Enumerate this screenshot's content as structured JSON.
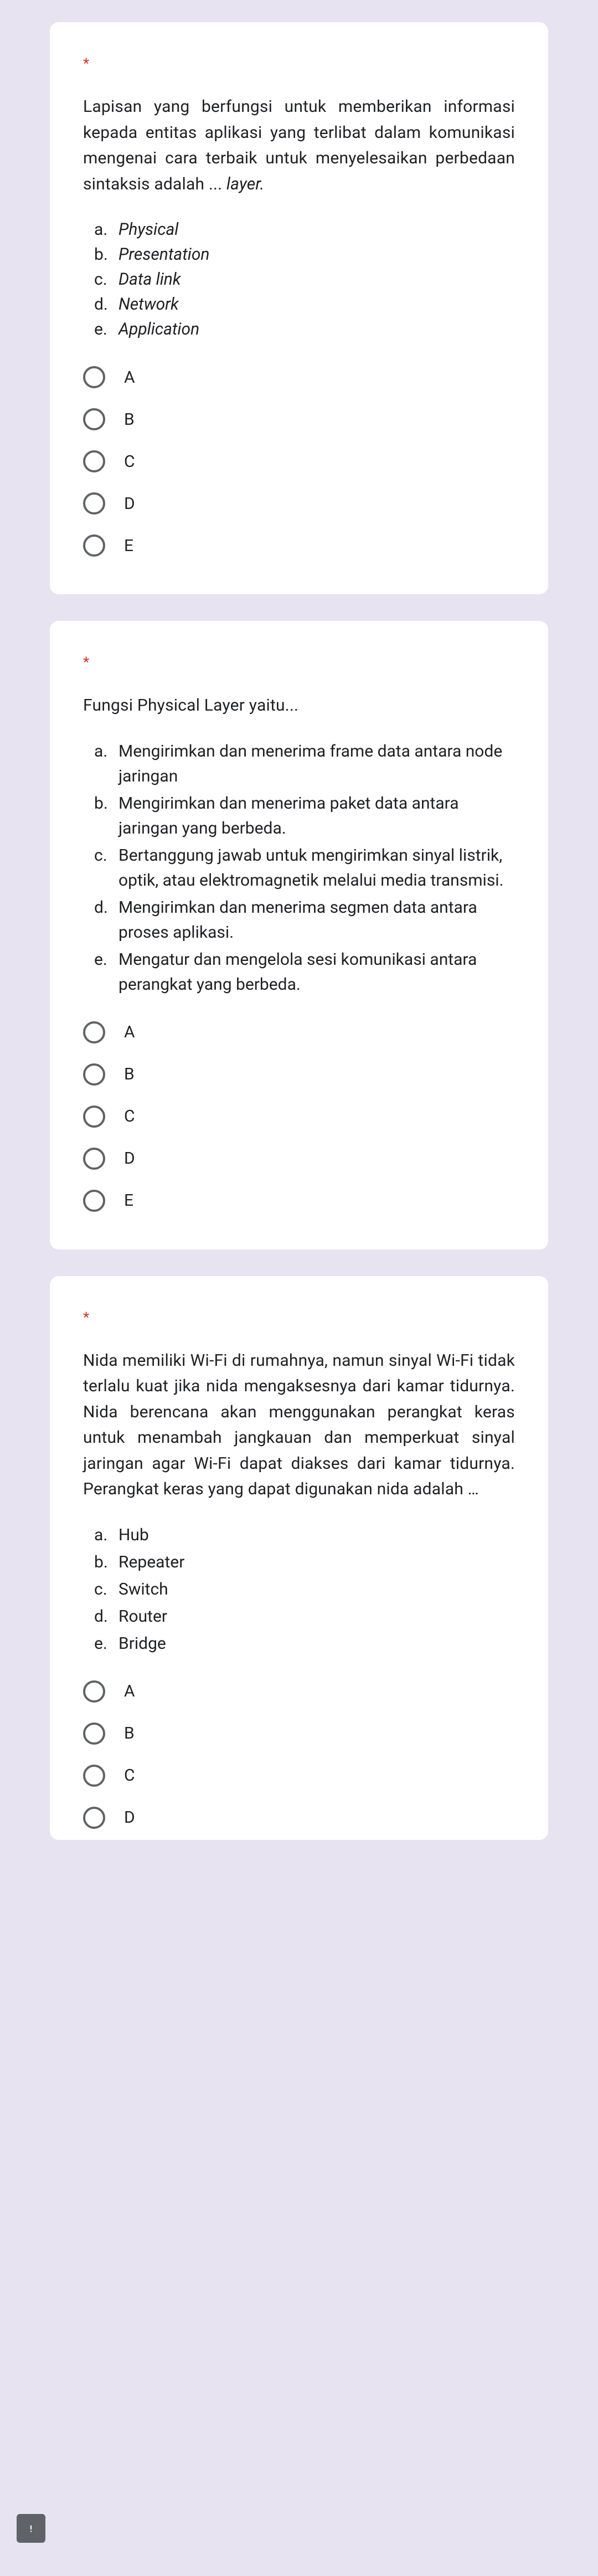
{
  "required_marker": "*",
  "choices": [
    "A",
    "B",
    "C",
    "D",
    "E"
  ],
  "questions": [
    {
      "id": "q1",
      "text_parts": [
        "Lapisan yang berfungsi untuk memberikan informasi kepada entitas aplikasi yang terlibat dalam komunikasi mengenai cara terbaik untuk menyelesaikan perbedaan sintaksis adalah ... ",
        "layer."
      ],
      "justify": true,
      "options_italic": true,
      "options": [
        {
          "letter": "a.",
          "text": "Physical"
        },
        {
          "letter": "b.",
          "text": "Presentation"
        },
        {
          "letter": "c.",
          "text": "Data link"
        },
        {
          "letter": "d.",
          "text": "Network"
        },
        {
          "letter": "e.",
          "text": "Application"
        }
      ]
    },
    {
      "id": "q2",
      "text_parts": [
        "Fungsi Physical Layer yaitu..."
      ],
      "justify": false,
      "options_italic": false,
      "options": [
        {
          "letter": "a.",
          "text": "Mengirimkan dan menerima frame data antara node jaringan"
        },
        {
          "letter": "b.",
          "text": "Mengirimkan dan menerima paket data antara jaringan yang berbeda."
        },
        {
          "letter": "c.",
          "text": "Bertanggung jawab untuk mengirimkan sinyal listrik, optik, atau elektromagnetik melalui media transmisi."
        },
        {
          "letter": "d.",
          "text": "Mengirimkan dan menerima segmen data antara proses aplikasi."
        },
        {
          "letter": "e.",
          "text": "Mengatur dan mengelola sesi komunikasi antara perangkat yang berbeda."
        }
      ]
    },
    {
      "id": "q3",
      "text_parts": [
        "Nida memiliki Wi-Fi di rumahnya, namun sinyal Wi-Fi tidak terlalu kuat jika nida mengaksesnya dari kamar tidurnya. Nida berencana akan menggunakan perangkat keras untuk menambah jangkauan dan memperkuat sinyal jaringan agar Wi-Fi dapat diakses dari kamar tidurnya. Perangkat keras yang dapat digunakan nida adalah …"
      ],
      "justify": true,
      "options_italic": false,
      "options": [
        {
          "letter": "a.",
          "text": "Hub"
        },
        {
          "letter": "b.",
          "text": "Repeater"
        },
        {
          "letter": "c.",
          "text": "Switch"
        },
        {
          "letter": "d.",
          "text": "Router"
        },
        {
          "letter": "e.",
          "text": "Bridge"
        }
      ]
    }
  ]
}
